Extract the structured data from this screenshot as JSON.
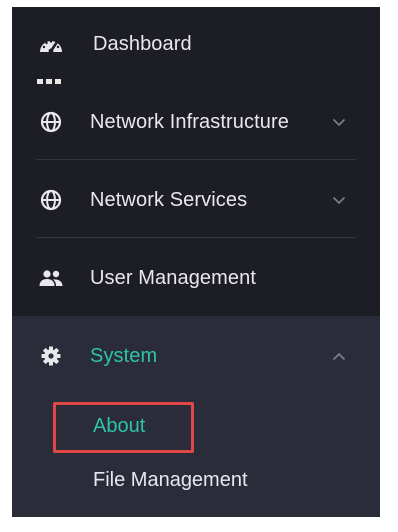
{
  "sidebar": {
    "items": [
      {
        "label": "Dashboard",
        "icon": "speedometer-icon"
      },
      {
        "label": "Network Infrastructure",
        "icon": "globe-icon",
        "expandable": true,
        "expanded": false
      },
      {
        "label": "Network Services",
        "icon": "globe-icon",
        "expandable": true,
        "expanded": false
      },
      {
        "label": "User Management",
        "icon": "users-icon"
      },
      {
        "label": "System",
        "icon": "gear-icon",
        "expandable": true,
        "expanded": true,
        "active": true
      }
    ],
    "system_children": [
      {
        "label": "About",
        "active": true,
        "highlighted": true
      },
      {
        "label": "File Management",
        "active": false
      }
    ]
  },
  "colors": {
    "sidebar_bg": "#1d1e25",
    "submenu_bg": "#2b2c3a",
    "text": "#e8e8ec",
    "accent": "#2ec4a8",
    "highlight_border": "#e04848",
    "chevron": "#7e808a"
  }
}
